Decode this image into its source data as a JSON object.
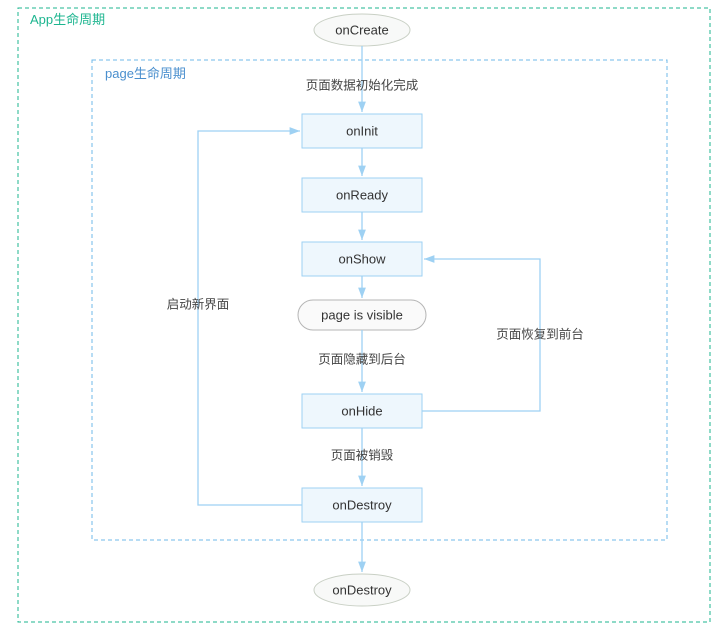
{
  "frames": {
    "app": {
      "title": "App生命周期"
    },
    "page": {
      "title": "page生命周期"
    }
  },
  "nodes": {
    "onCreate": {
      "label": "onCreate"
    },
    "onInit": {
      "label": "onInit"
    },
    "onReady": {
      "label": "onReady"
    },
    "onShow": {
      "label": "onShow"
    },
    "visible": {
      "label": "page is visible"
    },
    "onHide": {
      "label": "onHide"
    },
    "onDestroyP": {
      "label": "onDestroy"
    },
    "onDestroyA": {
      "label": "onDestroy"
    }
  },
  "edges": {
    "create_init": {
      "label": "页面数据初始化完成"
    },
    "visible_hide": {
      "label": "页面隐藏到后台"
    },
    "hide_show": {
      "label": "页面恢复到前台"
    },
    "hide_destroy": {
      "label": "页面被销毁"
    },
    "destroy_init": {
      "label": "启动新界面"
    }
  }
}
